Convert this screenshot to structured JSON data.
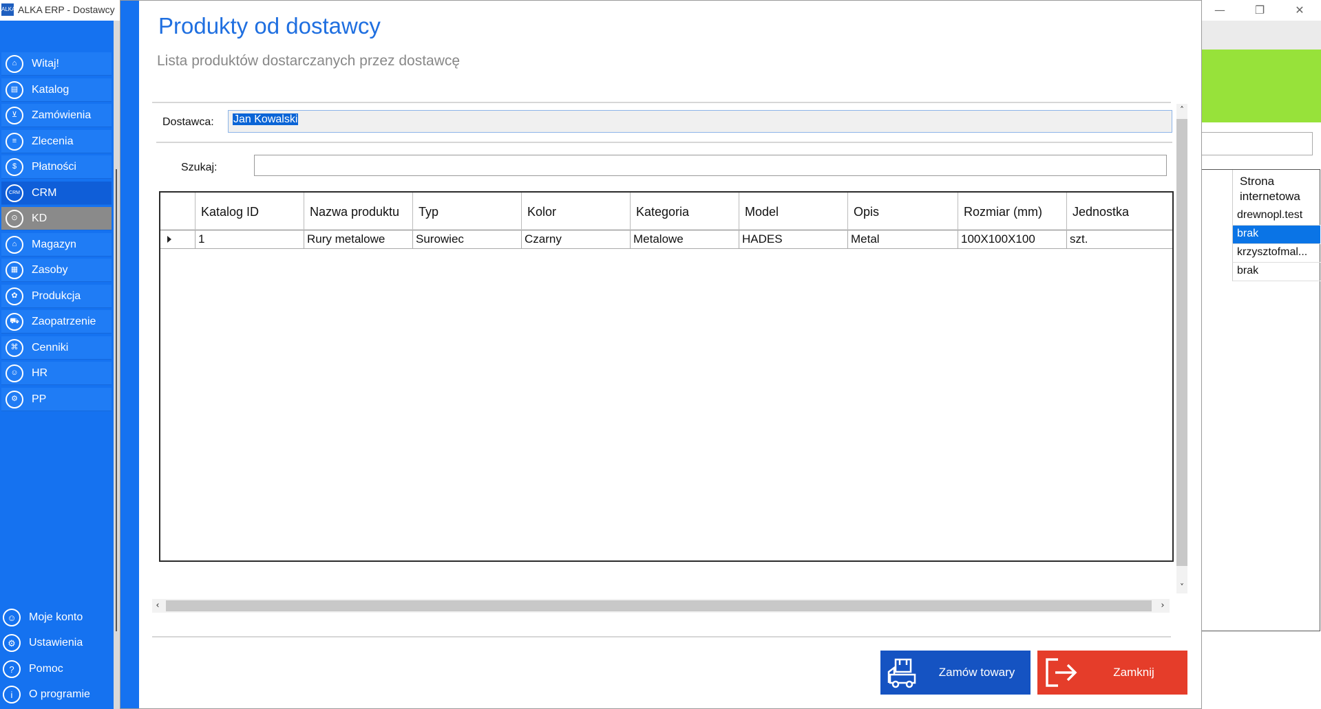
{
  "window": {
    "title": "ALKA ERP - Dostawcy",
    "app_icon_text": "ALKA",
    "minimize_glyph": "—",
    "restore_glyph": "❐",
    "close_glyph": "✕"
  },
  "sidebar": {
    "items": [
      {
        "label": "Witaj!",
        "icon": "home-icon",
        "glyph": "⌂"
      },
      {
        "label": "Katalog",
        "icon": "book-icon",
        "glyph": "▤"
      },
      {
        "label": "Zamówienia",
        "icon": "cart-icon",
        "glyph": "⊻"
      },
      {
        "label": "Zlecenia",
        "icon": "list-icon",
        "glyph": "≡"
      },
      {
        "label": "Płatności",
        "icon": "dollar-icon",
        "glyph": "$"
      },
      {
        "label": "CRM",
        "icon": "crm-icon",
        "glyph": "CRM"
      },
      {
        "label": "KD",
        "icon": "lock-icon",
        "glyph": "⊙"
      },
      {
        "label": "Magazyn",
        "icon": "warehouse-icon",
        "glyph": "⌂"
      },
      {
        "label": "Zasoby",
        "icon": "resources-icon",
        "glyph": "▦"
      },
      {
        "label": "Produkcja",
        "icon": "production-icon",
        "glyph": "✿"
      },
      {
        "label": "Zaopatrzenie",
        "icon": "truck-icon",
        "glyph": "⛟"
      },
      {
        "label": "Cenniki",
        "icon": "tag-icon",
        "glyph": "⌘"
      },
      {
        "label": "HR",
        "icon": "hr-icon",
        "glyph": "☺"
      },
      {
        "label": "PP",
        "icon": "pp-icon",
        "glyph": "⚙"
      }
    ],
    "bottom": [
      {
        "label": "Moje konto",
        "icon": "user-icon",
        "glyph": "☺"
      },
      {
        "label": "Ustawienia",
        "icon": "gear-icon",
        "glyph": "⚙"
      },
      {
        "label": "Pomoc",
        "icon": "help-icon",
        "glyph": "?"
      },
      {
        "label": "O programie",
        "icon": "info-icon",
        "glyph": "i"
      }
    ]
  },
  "background_grid": {
    "header": "Strona internetowa",
    "rows": [
      "drewnopl.test",
      "brak",
      "krzysztofmal...",
      "brak"
    ],
    "selected_row": 1
  },
  "dialog": {
    "title": "Produkty od dostawcy",
    "subtitle": "Lista produktów dostarczanych przez dostawcę",
    "supplier_label": "Dostawca:",
    "supplier_value": "Jan Kowalski",
    "search_label": "Szukaj:",
    "search_value": "",
    "columns": [
      "Katalog ID",
      "Nazwa produktu",
      "Typ",
      "Kolor",
      "Kategoria",
      "Model",
      "Opis",
      "Rozmiar (mm)",
      "Jednostka"
    ],
    "rows": [
      [
        "1",
        "Rury metalowe",
        "Surowiec",
        "Czarny",
        "Metalowe",
        "HADES",
        "Metal",
        "100X100X100",
        "szt."
      ]
    ],
    "scroll_up": "˄",
    "scroll_down": "˅",
    "scroll_left": "‹",
    "scroll_right": "›",
    "order_button": "Zamów towary",
    "close_button": "Zamknij"
  },
  "colors": {
    "sidebar": "#1572f0",
    "accent_title": "#1f6fe0",
    "order_button": "#1553c2",
    "close_button": "#e53d2a",
    "green_band": "#97e23a"
  }
}
